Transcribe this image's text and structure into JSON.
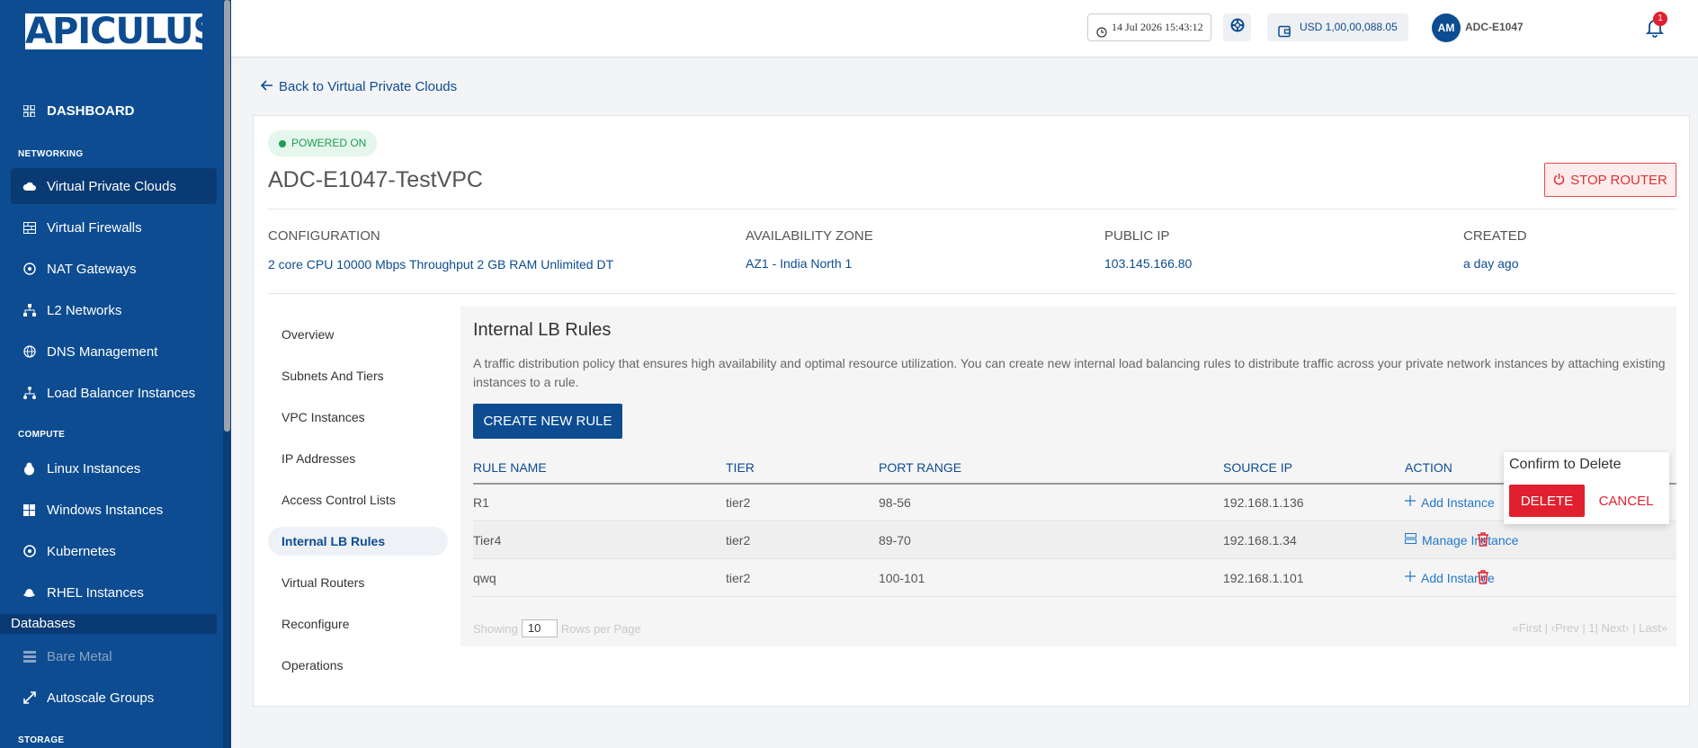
{
  "sidebar": {
    "logo": "APICULUS",
    "dashboard": "DASHBOARD",
    "sections": {
      "networking": "NETWORKING",
      "compute": "COMPUTE",
      "storage": "STORAGE"
    },
    "networking_items": [
      {
        "label": "Virtual Private Clouds",
        "icon": "cloud-icon"
      },
      {
        "label": "Virtual Firewalls",
        "icon": "firewall-icon"
      },
      {
        "label": "NAT Gateways",
        "icon": "nat-icon"
      },
      {
        "label": "L2 Networks",
        "icon": "network-icon"
      },
      {
        "label": "DNS Management",
        "icon": "globe-icon"
      },
      {
        "label": "Load Balancer Instances",
        "icon": "load-balancer-icon"
      }
    ],
    "compute_items": [
      {
        "label": "Linux Instances",
        "icon": "linux-icon"
      },
      {
        "label": "Windows Instances",
        "icon": "windows-icon"
      },
      {
        "label": "Kubernetes",
        "icon": "kubernetes-icon"
      },
      {
        "label": "RHEL Instances",
        "icon": "redhat-icon"
      }
    ],
    "databases": "Databases",
    "bare_metal": "Bare Metal",
    "autoscale": "Autoscale Groups"
  },
  "topbar": {
    "datetime": "14 Jul 2026 15:43:12",
    "balance": "USD 1,00,00,088.05",
    "avatar_initials": "AM",
    "username": "ADC-E1047",
    "notifications": "1"
  },
  "back_link": "Back to Virtual Private Clouds",
  "vpc": {
    "status": "POWERED ON",
    "name": "ADC-E1047-TestVPC",
    "stop_label": "STOP ROUTER",
    "config_label": "CONFIGURATION",
    "config_value": "2 core CPU 10000 Mbps Throughput 2 GB RAM Unlimited DT",
    "zone_label": "AVAILABILITY ZONE",
    "zone_value": "AZ1 - India North 1",
    "ip_label": "PUBLIC IP",
    "ip_value": "103.145.166.80",
    "created_label": "CREATED",
    "created_value": "a day ago"
  },
  "subnav": [
    "Overview",
    "Subnets And Tiers",
    "VPC Instances",
    "IP Addresses",
    "Access Control Lists",
    "Internal LB Rules",
    "Virtual Routers",
    "Reconfigure",
    "Operations"
  ],
  "panel": {
    "title": "Internal LB Rules",
    "description": "A traffic distribution policy that ensures high availability and optimal resource utilization. You can create new internal load balancing rules to distribute traffic across your private network instances by attaching existing instances to a rule.",
    "create_label": "CREATE NEW RULE",
    "columns": [
      "RULE NAME",
      "TIER",
      "PORT RANGE",
      "SOURCE IP",
      "ACTION"
    ],
    "rows": [
      {
        "name": "R1",
        "tier": "tier2",
        "ports": "98-56",
        "source": "192.168.1.136",
        "action": "Add Instance"
      },
      {
        "name": "Tier4",
        "tier": "tier2",
        "ports": "89-70",
        "source": "192.168.1.34",
        "action": "Manage Instance"
      },
      {
        "name": "qwq",
        "tier": "tier2",
        "ports": "100-101",
        "source": "192.168.1.101",
        "action": "Add Instance"
      }
    ],
    "showing": "Showing",
    "rows_value": "10",
    "rows_per_page": "Rows per Page",
    "pager": "«First | ‹Prev | 1| Next› | Last»"
  },
  "confirm": {
    "title": "Confirm to Delete",
    "delete_label": "DELETE",
    "cancel_label": "CANCEL"
  }
}
